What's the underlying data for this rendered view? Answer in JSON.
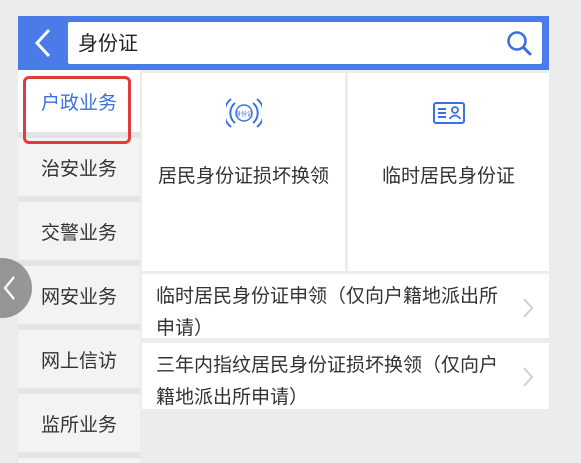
{
  "search": {
    "query": "身份证"
  },
  "sidebar": {
    "items": [
      {
        "label": "户政业务",
        "active": true
      },
      {
        "label": "治安业务",
        "active": false
      },
      {
        "label": "交警业务",
        "active": false
      },
      {
        "label": "网安业务",
        "active": false
      },
      {
        "label": "网上信访",
        "active": false
      },
      {
        "label": "监所业务",
        "active": false
      }
    ]
  },
  "main": {
    "cards": [
      {
        "label": "居民身份证损坏换领",
        "icon": "id-card-nfc-icon",
        "icon_text": "身份证"
      },
      {
        "label": "临时居民身份证",
        "icon": "id-card-icon"
      }
    ],
    "list": [
      {
        "label": "临时居民身份证申领（仅向户籍地派出所申请）"
      },
      {
        "label": "三年内指纹居民身份证损坏换领（仅向户籍地派出所申请）"
      }
    ]
  },
  "colors": {
    "accent": "#4a7be8",
    "active_text": "#3c6fe0",
    "highlight_border": "#e23b3b"
  }
}
